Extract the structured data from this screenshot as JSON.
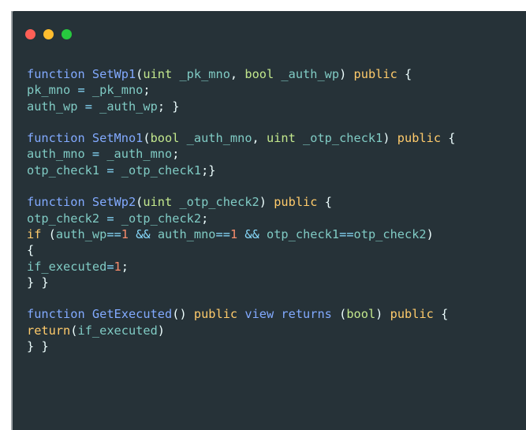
{
  "window": {
    "controls": [
      "close",
      "minimize",
      "maximize"
    ]
  },
  "code_lines": [
    "function SetWp1(uint _pk_mno, bool _auth_wp) public {",
    "pk_mno = _pk_mno;",
    "auth_wp = _auth_wp; }",
    "",
    "function SetMno1(bool _auth_mno, uint _otp_check1) public {",
    "auth_mno = _auth_mno;",
    "otp_check1 = _otp_check1;}",
    "",
    "function SetWp2(uint _otp_check2) public {",
    "otp_check2 = _otp_check2;",
    "if (auth_wp==1 && auth_mno==1 && otp_check1==otp_check2)",
    "{",
    "if_executed=1;",
    "} }",
    "",
    "function GetExecuted() public view returns (bool) public {",
    "return(if_executed)",
    "} }"
  ],
  "colors": {
    "background": "#263238",
    "identifier": "#80cbc4",
    "keyword": "#82aaff",
    "type": "#c3e88d",
    "modifier": "#ffcb6b",
    "number": "#f78c6c",
    "operator": "#89ddff"
  }
}
